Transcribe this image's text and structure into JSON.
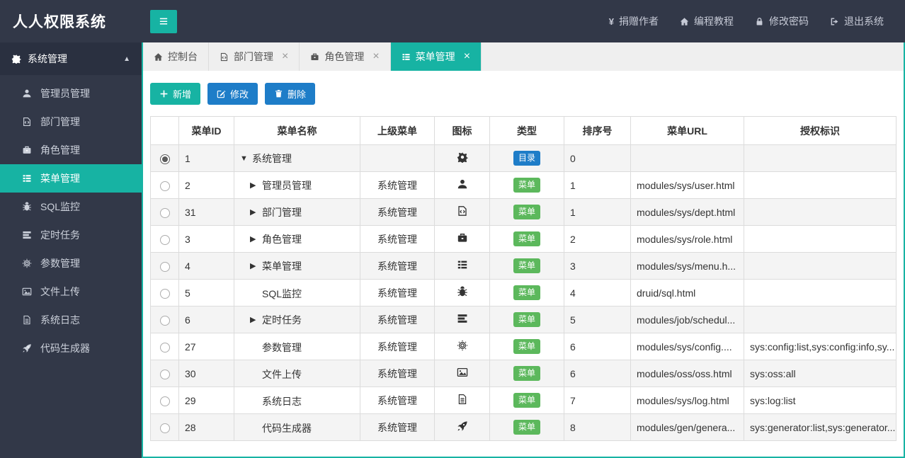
{
  "header": {
    "title": "人人权限系统",
    "toggle_icon": "hamburger-icon",
    "links": [
      {
        "icon": "yen-icon",
        "label": "捐赠作者"
      },
      {
        "icon": "home-icon",
        "label": "编程教程"
      },
      {
        "icon": "lock-icon",
        "label": "修改密码"
      },
      {
        "icon": "logout-icon",
        "label": "退出系统"
      }
    ]
  },
  "sidebar": {
    "group": {
      "icon": "gear-icon",
      "label": "系统管理",
      "caret_icon": "chevron-up-icon"
    },
    "items": [
      {
        "icon": "user-icon",
        "label": "管理员管理",
        "active": false
      },
      {
        "icon": "dept-icon",
        "label": "部门管理",
        "active": false
      },
      {
        "icon": "role-icon",
        "label": "角色管理",
        "active": false
      },
      {
        "icon": "menu-icon",
        "label": "菜单管理",
        "active": true
      },
      {
        "icon": "bug-icon",
        "label": "SQL监控",
        "active": false
      },
      {
        "icon": "tasks-icon",
        "label": "定时任务",
        "active": false
      },
      {
        "icon": "config-icon",
        "label": "参数管理",
        "active": false
      },
      {
        "icon": "upload-icon",
        "label": "文件上传",
        "active": false
      },
      {
        "icon": "log-icon",
        "label": "系统日志",
        "active": false
      },
      {
        "icon": "rocket-icon",
        "label": "代码生成器",
        "active": false
      }
    ]
  },
  "tabs": [
    {
      "icon": "home-icon",
      "label": "控制台",
      "closable": false,
      "active": false
    },
    {
      "icon": "dept-icon",
      "label": "部门管理",
      "closable": true,
      "active": false
    },
    {
      "icon": "role-icon",
      "label": "角色管理",
      "closable": true,
      "active": false
    },
    {
      "icon": "menu-icon",
      "label": "菜单管理",
      "closable": true,
      "active": true
    }
  ],
  "toolbar": {
    "add_icon": "plus-icon",
    "add_label": "新增",
    "edit_icon": "edit-icon",
    "edit_label": "修改",
    "delete_icon": "trash-icon",
    "delete_label": "删除"
  },
  "table": {
    "columns": [
      "",
      "菜单ID",
      "菜单名称",
      "上级菜单",
      "图标",
      "类型",
      "排序号",
      "菜单URL",
      "授权标识"
    ],
    "badge_colors": {
      "目录": "#1e7dc8",
      "菜单": "#5cb85c"
    },
    "rows": [
      {
        "selected": true,
        "menu_id": "1",
        "name": "系统管理",
        "tree": "expanded",
        "parent": "",
        "icon": "gear-icon",
        "type": "目录",
        "order": "0",
        "url": "",
        "perms": ""
      },
      {
        "selected": false,
        "menu_id": "2",
        "name": "管理员管理",
        "tree": "collapsed",
        "parent": "系统管理",
        "icon": "user-icon",
        "type": "菜单",
        "order": "1",
        "url": "modules/sys/user.html",
        "perms": ""
      },
      {
        "selected": false,
        "menu_id": "31",
        "name": "部门管理",
        "tree": "collapsed",
        "parent": "系统管理",
        "icon": "dept-icon",
        "type": "菜单",
        "order": "1",
        "url": "modules/sys/dept.html",
        "perms": ""
      },
      {
        "selected": false,
        "menu_id": "3",
        "name": "角色管理",
        "tree": "collapsed",
        "parent": "系统管理",
        "icon": "role-icon",
        "type": "菜单",
        "order": "2",
        "url": "modules/sys/role.html",
        "perms": ""
      },
      {
        "selected": false,
        "menu_id": "4",
        "name": "菜单管理",
        "tree": "collapsed",
        "parent": "系统管理",
        "icon": "menu-icon",
        "type": "菜单",
        "order": "3",
        "url": "modules/sys/menu.h...",
        "perms": ""
      },
      {
        "selected": false,
        "menu_id": "5",
        "name": "SQL监控",
        "tree": "none",
        "parent": "系统管理",
        "icon": "bug-icon",
        "type": "菜单",
        "order": "4",
        "url": "druid/sql.html",
        "perms": ""
      },
      {
        "selected": false,
        "menu_id": "6",
        "name": "定时任务",
        "tree": "collapsed",
        "parent": "系统管理",
        "icon": "tasks-icon",
        "type": "菜单",
        "order": "5",
        "url": "modules/job/schedul...",
        "perms": ""
      },
      {
        "selected": false,
        "menu_id": "27",
        "name": "参数管理",
        "tree": "none",
        "parent": "系统管理",
        "icon": "config-icon",
        "type": "菜单",
        "order": "6",
        "url": "modules/sys/config....",
        "perms": "sys:config:list,sys:config:info,sy..."
      },
      {
        "selected": false,
        "menu_id": "30",
        "name": "文件上传",
        "tree": "none",
        "parent": "系统管理",
        "icon": "upload-icon",
        "type": "菜单",
        "order": "6",
        "url": "modules/oss/oss.html",
        "perms": "sys:oss:all"
      },
      {
        "selected": false,
        "menu_id": "29",
        "name": "系统日志",
        "tree": "none",
        "parent": "系统管理",
        "icon": "log-icon",
        "type": "菜单",
        "order": "7",
        "url": "modules/sys/log.html",
        "perms": "sys:log:list"
      },
      {
        "selected": false,
        "menu_id": "28",
        "name": "代码生成器",
        "tree": "none",
        "parent": "系统管理",
        "icon": "rocket-icon",
        "type": "菜单",
        "order": "8",
        "url": "modules/gen/genera...",
        "perms": "sys:generator:list,sys:generator..."
      }
    ]
  },
  "colors": {
    "accent_teal": "#17b3a3",
    "primary_blue": "#1e7dc8",
    "badge_green": "#5cb85c",
    "dark_bg": "#323848"
  }
}
